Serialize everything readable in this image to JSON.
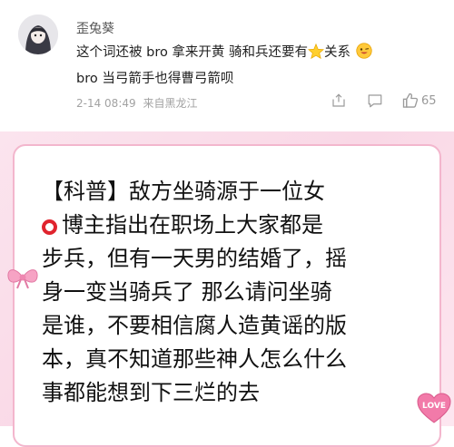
{
  "comment": {
    "username": "歪兔葵",
    "line1_part1": "这个词还被 bro 拿来开黄  骑和兵还要有",
    "line1_part2": "关系",
    "line2": "bro 当弓箭手也得曹弓箭呗",
    "timestamp": "2-14 08:49",
    "location": "来自黑龙江",
    "like_count": "65",
    "icons": [
      "share-icon",
      "comment-icon",
      "like-icon",
      "star-icon",
      "smile-emoji-icon"
    ]
  },
  "card": {
    "lines": [
      "【科普】敌方坐骑源于一位女",
      "博主指出在职场上大家都是",
      "步兵，但有一天男的结婚了，摇",
      "身一变当骑兵了  那么请问坐骑",
      "是谁，不要相信腐人造黄谣的版",
      "本，真不知道那些神人怎么什么",
      "事都能想到下三烂的去"
    ],
    "love_sticker": "LOVE"
  },
  "colors": {
    "card_border": "#f3b6cd",
    "background_pink": "#f9d8e6",
    "ring_red": "#e0242e",
    "meta_gray": "#a2a2a2"
  }
}
